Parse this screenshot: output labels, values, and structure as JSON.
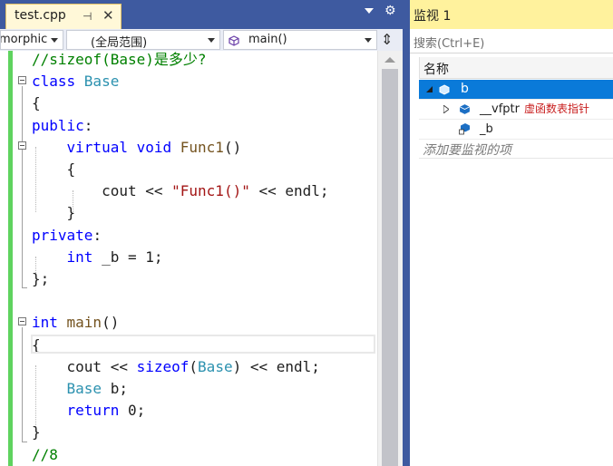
{
  "editor_tab": {
    "title": "test.cpp",
    "pin_glyph": "⊣",
    "close_glyph": "✕"
  },
  "nav": {
    "project": "morphic",
    "scope": "(全局范围)",
    "function": "main()"
  },
  "code_lines": [
    [
      {
        "t": "//sizeof(Base)是多少?",
        "c": "cm"
      }
    ],
    [
      {
        "t": "class ",
        "c": "kw"
      },
      {
        "t": "Base",
        "c": "ty"
      }
    ],
    [
      {
        "t": "{",
        "c": "tx"
      }
    ],
    [
      {
        "t": "public",
        "c": "kw"
      },
      {
        "t": ":",
        "c": "tx"
      }
    ],
    [
      {
        "t": "    virtual ",
        "c": "kw"
      },
      {
        "t": "void ",
        "c": "kw"
      },
      {
        "t": "Func1",
        "c": "fn"
      },
      {
        "t": "()",
        "c": "tx"
      }
    ],
    [
      {
        "t": "    {",
        "c": "tx"
      }
    ],
    [
      {
        "t": "        cout ",
        "c": "tx"
      },
      {
        "t": "<< ",
        "c": "tx"
      },
      {
        "t": "\"Func1()\"",
        "c": "st"
      },
      {
        "t": " << endl;",
        "c": "tx"
      }
    ],
    [
      {
        "t": "    }",
        "c": "tx"
      }
    ],
    [
      {
        "t": "private",
        "c": "kw"
      },
      {
        "t": ":",
        "c": "tx"
      }
    ],
    [
      {
        "t": "    int ",
        "c": "kw"
      },
      {
        "t": "_b = 1;",
        "c": "tx"
      }
    ],
    [
      {
        "t": "};",
        "c": "tx"
      }
    ],
    [
      {
        "t": "",
        "c": "tx"
      }
    ],
    [
      {
        "t": "int ",
        "c": "kw"
      },
      {
        "t": "main",
        "c": "fn"
      },
      {
        "t": "()",
        "c": "tx"
      }
    ],
    [
      {
        "t": "{",
        "c": "tx"
      }
    ],
    [
      {
        "t": "    cout ",
        "c": "tx"
      },
      {
        "t": "<< ",
        "c": "tx"
      },
      {
        "t": "sizeof",
        "c": "kw"
      },
      {
        "t": "(",
        "c": "tx"
      },
      {
        "t": "Base",
        "c": "ty"
      },
      {
        "t": ") << endl;",
        "c": "tx"
      }
    ],
    [
      {
        "t": "    Base ",
        "c": "ty"
      },
      {
        "t": "b;",
        "c": "tx"
      }
    ],
    [
      {
        "t": "    return ",
        "c": "kw"
      },
      {
        "t": "0;",
        "c": "tx"
      }
    ],
    [
      {
        "t": "}",
        "c": "tx"
      }
    ],
    [
      {
        "t": "//8",
        "c": "cm"
      }
    ]
  ],
  "watch": {
    "title": "监视 1",
    "search_placeholder": "搜索(Ctrl+E)",
    "column_name": "名称",
    "rows": {
      "b": "b",
      "vfptr": "__vfptr",
      "vfptr_note": "虚函数表指针",
      "_b": "_b"
    },
    "add_hint": "添加要监视的项"
  },
  "colors": {
    "accent": "#3e5aa0",
    "tab_active": "#fff8d8",
    "watch_title": "#fff29d",
    "selection": "#0a7ad9",
    "change_bar": "#5fd35f"
  }
}
